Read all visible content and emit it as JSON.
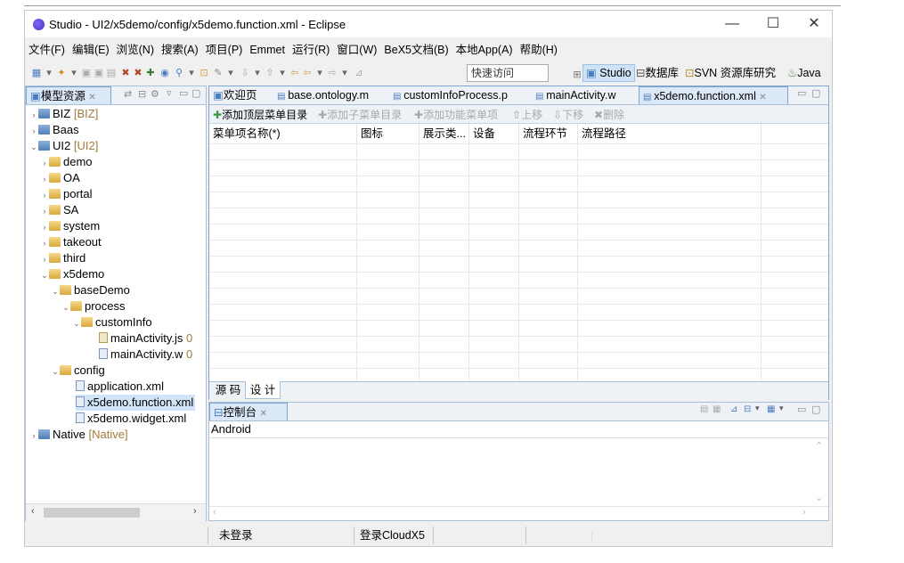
{
  "window": {
    "title": "Studio - UI2/x5demo/config/x5demo.function.xml - Eclipse",
    "controls": {
      "minimize": "—",
      "maximize": "☐",
      "close": "✕"
    }
  },
  "menu": [
    "文件(F)",
    "编辑(E)",
    "浏览(N)",
    "搜索(A)",
    "项目(P)",
    "Emmet",
    "运行(R)",
    "窗口(W)",
    "BeX5文档(B)",
    "本地App(A)",
    "帮助(H)"
  ],
  "toolbar": {
    "quick_access": "快速访问",
    "perspectives": [
      "Studio",
      "数据库",
      "SVN 资源库研究",
      "Java"
    ]
  },
  "explorer": {
    "title": "模型资源",
    "tree": [
      {
        "label": "BIZ",
        "tag": "[BIZ]",
        "expanded": false
      },
      {
        "label": "Baas",
        "tag": "",
        "expanded": false
      },
      {
        "label": "UI2",
        "tag": "[UI2]",
        "expanded": true
      },
      {
        "label": "demo"
      },
      {
        "label": "OA"
      },
      {
        "label": "portal"
      },
      {
        "label": "SA"
      },
      {
        "label": "system"
      },
      {
        "label": "takeout"
      },
      {
        "label": "third"
      },
      {
        "label": "x5demo"
      },
      {
        "label": "baseDemo"
      },
      {
        "label": "process"
      },
      {
        "label": "customInfo"
      },
      {
        "label": "mainActivity.js",
        "tag": "0"
      },
      {
        "label": "mainActivity.w",
        "tag": "0"
      },
      {
        "label": "config"
      },
      {
        "label": "application.xml"
      },
      {
        "label": "x5demo.function.xml"
      },
      {
        "label": "x5demo.widget.xml"
      },
      {
        "label": "Native",
        "tag": "[Native]"
      }
    ]
  },
  "editor": {
    "tabs": [
      "欢迎页",
      "base.ontology.m",
      "customInfoProcess.p",
      "mainActivity.w",
      "x5demo.function.xml"
    ],
    "actions": [
      "添加顶层菜单目录",
      "添加子菜单目录",
      "添加功能菜单项",
      "上移",
      "下移",
      "删除"
    ],
    "columns": [
      "菜单项名称(*)",
      "图标",
      "展示类...",
      "设备",
      "流程环节",
      "流程路径"
    ],
    "bottom_tabs": [
      "源 码",
      "设 计"
    ]
  },
  "console": {
    "title": "控制台",
    "content": "Android"
  },
  "status": {
    "login": "未登录",
    "cloud": "登录CloudX5"
  },
  "colors": {
    "accent": "#4a7cc0",
    "selection": "#d2e4f7",
    "green_add": "#3c9a3c"
  }
}
